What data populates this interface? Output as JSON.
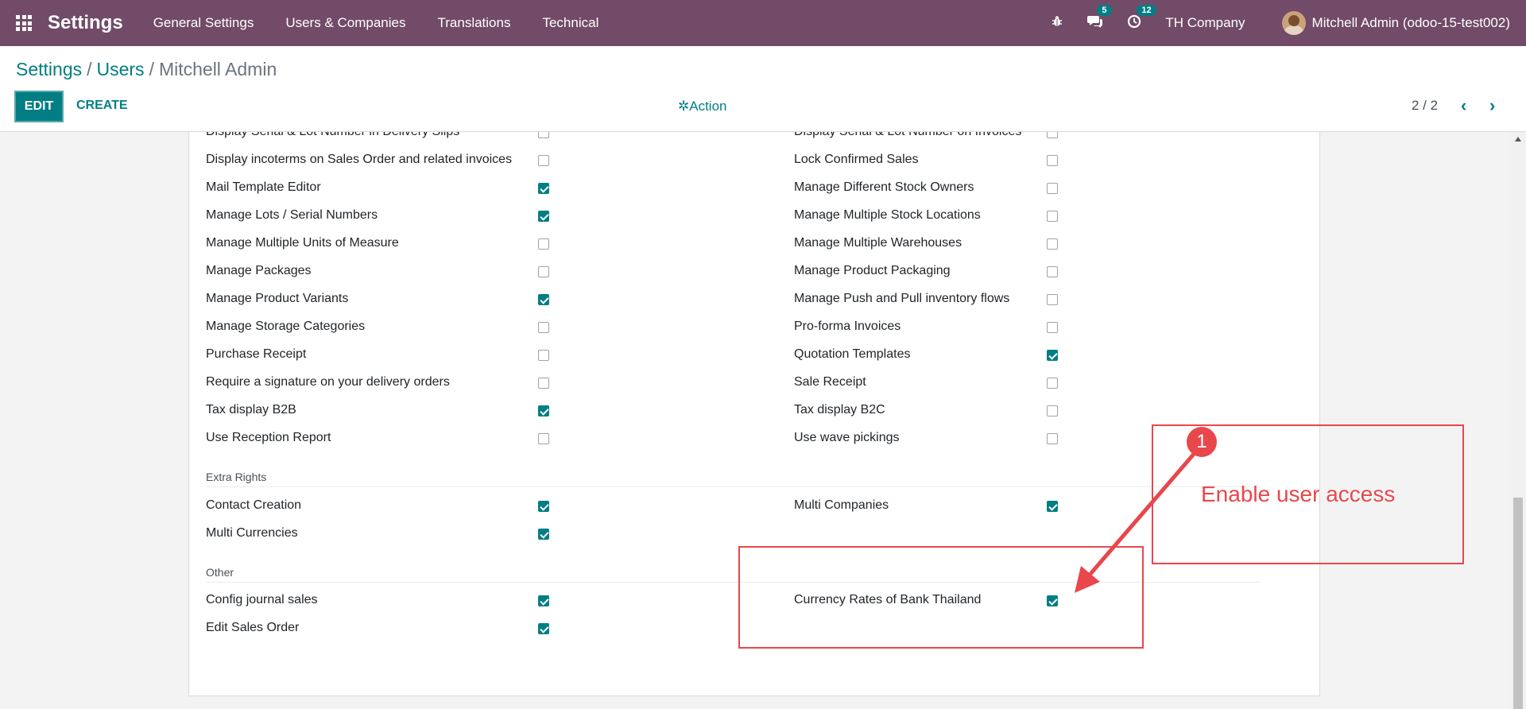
{
  "navbar": {
    "brand": "Settings",
    "menu": [
      "General Settings",
      "Users & Companies",
      "Translations",
      "Technical"
    ],
    "messages_count": "5",
    "activities_count": "12",
    "company": "TH Company",
    "user": "Mitchell Admin (odoo-15-test002)"
  },
  "breadcrumb": {
    "item1": "Settings",
    "sep1": "/",
    "item2": "Users",
    "sep2": "/",
    "current": "Mitchell Admin"
  },
  "control": {
    "edit": "EDIT",
    "create": "CREATE",
    "action": "Action",
    "pager": "2 / 2"
  },
  "rights": {
    "rows": [
      {
        "left": "Display Serial & Lot Number in Delivery Slips",
        "left_checked": false,
        "right": "Display Serial & Lot Number on Invoices",
        "right_checked": false
      },
      {
        "left": "Display incoterms on Sales Order and related invoices",
        "left_checked": false,
        "right": "Lock Confirmed Sales",
        "right_checked": false
      },
      {
        "left": "Mail Template Editor",
        "left_checked": true,
        "right": "Manage Different Stock Owners",
        "right_checked": false
      },
      {
        "left": "Manage Lots / Serial Numbers",
        "left_checked": true,
        "right": "Manage Multiple Stock Locations",
        "right_checked": false
      },
      {
        "left": "Manage Multiple Units of Measure",
        "left_checked": false,
        "right": "Manage Multiple Warehouses",
        "right_checked": false
      },
      {
        "left": "Manage Packages",
        "left_checked": false,
        "right": "Manage Product Packaging",
        "right_checked": false
      },
      {
        "left": "Manage Product Variants",
        "left_checked": true,
        "right": "Manage Push and Pull inventory flows",
        "right_checked": false
      },
      {
        "left": "Manage Storage Categories",
        "left_checked": false,
        "right": "Pro-forma Invoices",
        "right_checked": false
      },
      {
        "left": "Purchase Receipt",
        "left_checked": false,
        "right": "Quotation Templates",
        "right_checked": true
      },
      {
        "left": "Require a signature on your delivery orders",
        "left_checked": false,
        "right": "Sale Receipt",
        "right_checked": false
      },
      {
        "left": "Tax display B2B",
        "left_checked": true,
        "right": "Tax display B2C",
        "right_checked": false
      },
      {
        "left": "Use Reception Report",
        "left_checked": false,
        "right": "Use wave pickings",
        "right_checked": false
      }
    ]
  },
  "extra_rights": {
    "title": "Extra Rights",
    "contact_creation": "Contact Creation",
    "contact_creation_checked": true,
    "multi_companies": "Multi Companies",
    "multi_companies_checked": true,
    "multi_currencies": "Multi Currencies",
    "multi_currencies_checked": true
  },
  "other": {
    "title": "Other",
    "config_journal_sales": "Config journal sales",
    "config_journal_sales_checked": true,
    "currency_rates": "Currency Rates of Bank Thailand",
    "currency_rates_checked": true,
    "edit_sales_order": "Edit Sales Order",
    "edit_sales_order_checked": true
  },
  "annotation": {
    "step": "1",
    "text": "Enable user access",
    "color": "#e8474c"
  },
  "colors": {
    "navbar": "#714b67",
    "accent": "#017e84"
  },
  "icons": {
    "apps": "apps-grid-icon",
    "debug": "bug-icon",
    "messages": "chat-icon",
    "activities": "clock-icon",
    "action": "gear-icon",
    "prev": "chevron-left-icon",
    "next": "chevron-right-icon"
  }
}
